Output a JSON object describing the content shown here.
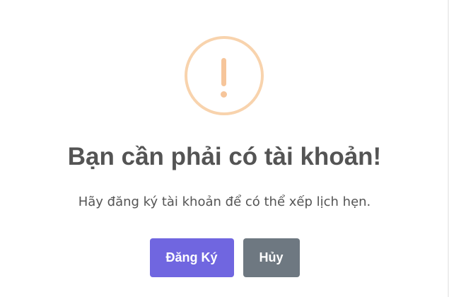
{
  "dialog": {
    "icon": "warning-icon",
    "title": "Bạn cần phải có tài khoản!",
    "message": "Hãy đăng ký tài khoản để có thể xếp lịch hẹn.",
    "confirm_label": "Đăng Ký",
    "cancel_label": "Hủy"
  },
  "colors": {
    "icon_ring": "#f8d3ad",
    "icon_mark": "#f6c59a",
    "text": "#545454",
    "confirm_button": "#7066e0",
    "cancel_button": "#6e7881"
  }
}
